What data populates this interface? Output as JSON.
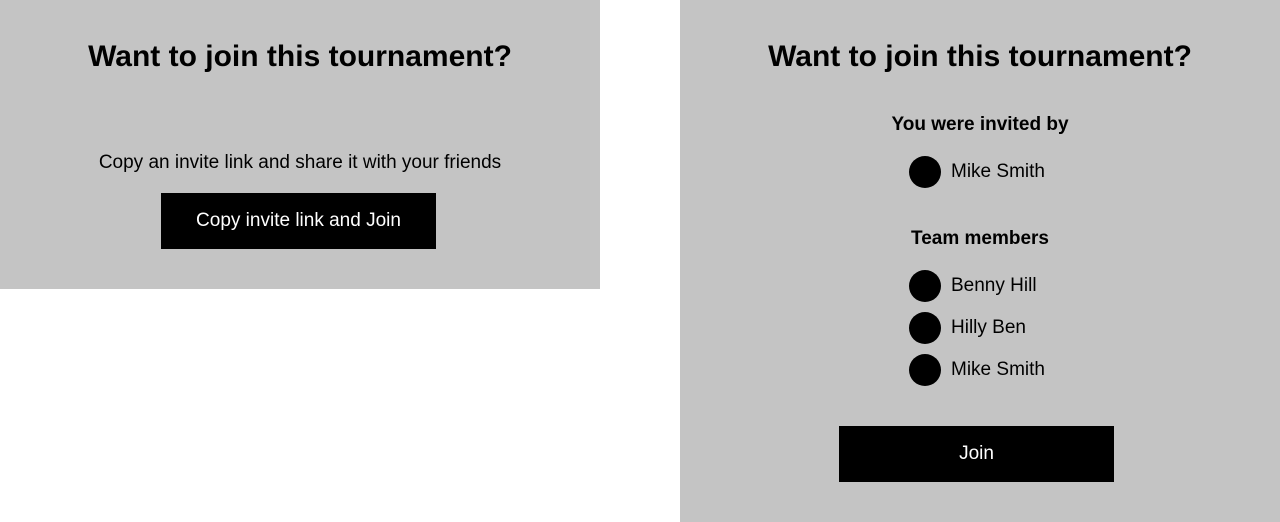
{
  "left_panel": {
    "title": "Want to join this tournament?",
    "invite_text": "Copy an invite link and share it with your friends",
    "copy_button_label": "Copy invite link and Join"
  },
  "right_panel": {
    "title": "Want to join this tournament?",
    "invited_by_label": "You were invited by",
    "inviter": {
      "name": "Mike Smith"
    },
    "team_members_label": "Team members",
    "team_members": [
      {
        "name": "Benny Hill"
      },
      {
        "name": "Hilly Ben"
      },
      {
        "name": "Mike Smith"
      }
    ],
    "join_button_label": "Join"
  },
  "colors": {
    "panel_background": "#c4c4c4",
    "button_background": "#000000",
    "button_text": "#ffffff",
    "avatar": "#000000"
  }
}
